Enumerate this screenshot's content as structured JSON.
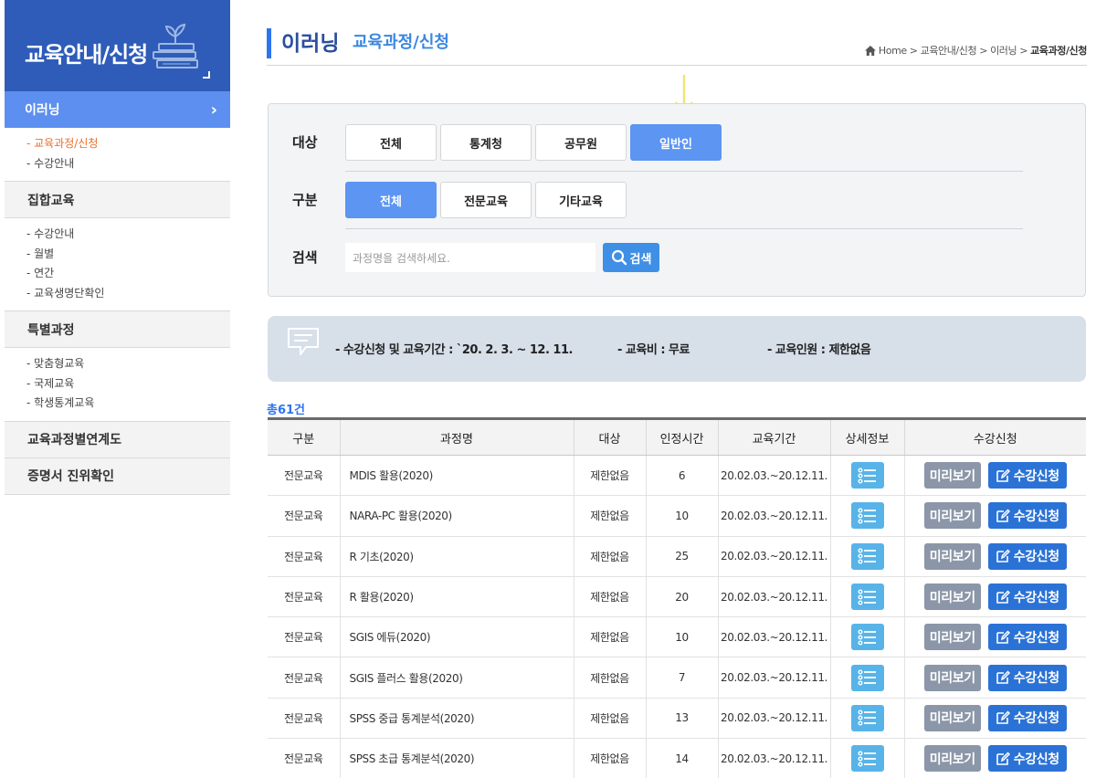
{
  "sidebar": {
    "title": "교육안내/신청",
    "active_item": "이러닝",
    "elearning_sub": [
      "- 교육과정/신청",
      "- 수강안내"
    ],
    "groups": [
      {
        "label": "집합교육",
        "sub": [
          "- 수강안내",
          "- 월별",
          "- 연간",
          "- 교육생명단확인"
        ]
      },
      {
        "label": "특별과정",
        "sub": [
          "- 맞춤형교육",
          "- 국제교육",
          "- 학생통계교육"
        ]
      },
      {
        "label": "교육과정별연계도",
        "sub": []
      },
      {
        "label": "증명서 진위확인",
        "sub": []
      }
    ]
  },
  "header": {
    "title": "이러닝",
    "subtitle": "교육과정/신청",
    "breadcrumb": [
      "Home",
      "교육안내/신청",
      "이러닝",
      "교육과정/신청"
    ]
  },
  "filter": {
    "target_label": "대상",
    "target_options": [
      "전체",
      "통계청",
      "공무원",
      "일반인"
    ],
    "target_selected": "일반인",
    "type_label": "구분",
    "type_options": [
      "전체",
      "전문교육",
      "기타교육"
    ],
    "type_selected": "전체",
    "search_label": "검색",
    "search_placeholder": "과정명을 검색하세요.",
    "search_button": "검색"
  },
  "info": {
    "period": "- 수강신청 및 교육기간 : `20. 2. 3. ~ 12. 11.",
    "fee": "- 교육비 : 무료",
    "capacity": "- 교육인원 : 제한없음"
  },
  "total": "총61건",
  "table": {
    "headers": [
      "구분",
      "과정명",
      "대상",
      "인정시간",
      "교육기간",
      "상세정보",
      "수강신청"
    ],
    "preview_label": "미리보기",
    "apply_label": "수강신청",
    "rows": [
      {
        "type": "전문교육",
        "name": "MDIS 활용(2020)",
        "target": "제한없음",
        "hours": "6",
        "period": "20.02.03.~20.12.11."
      },
      {
        "type": "전문교육",
        "name": "NARA-PC 활용(2020)",
        "target": "제한없음",
        "hours": "10",
        "period": "20.02.03.~20.12.11."
      },
      {
        "type": "전문교육",
        "name": "R 기초(2020)",
        "target": "제한없음",
        "hours": "25",
        "period": "20.02.03.~20.12.11."
      },
      {
        "type": "전문교육",
        "name": "R 활용(2020)",
        "target": "제한없음",
        "hours": "20",
        "period": "20.02.03.~20.12.11."
      },
      {
        "type": "전문교육",
        "name": "SGIS 에듀(2020)",
        "target": "제한없음",
        "hours": "10",
        "period": "20.02.03.~20.12.11."
      },
      {
        "type": "전문교육",
        "name": "SGIS 플러스 활용(2020)",
        "target": "제한없음",
        "hours": "7",
        "period": "20.02.03.~20.12.11."
      },
      {
        "type": "전문교육",
        "name": "SPSS 중급 통계분석(2020)",
        "target": "제한없음",
        "hours": "13",
        "period": "20.02.03.~20.12.11."
      },
      {
        "type": "전문교육",
        "name": "SPSS 초급 통계분석(2020)",
        "target": "제한없음",
        "hours": "14",
        "period": "20.02.03.~20.12.11."
      }
    ]
  },
  "icons": {
    "home": "home-icon",
    "search": "search-icon",
    "detail": "list-icon",
    "apply": "edit-icon",
    "info": "speech-bubble-icon"
  },
  "colors": {
    "brand": "#2e5cb8",
    "accent": "#5c8ff0",
    "active_sub": "#e8702a",
    "apply": "#2b72d6",
    "preview": "#8b96a8",
    "detail": "#58b4e8"
  }
}
